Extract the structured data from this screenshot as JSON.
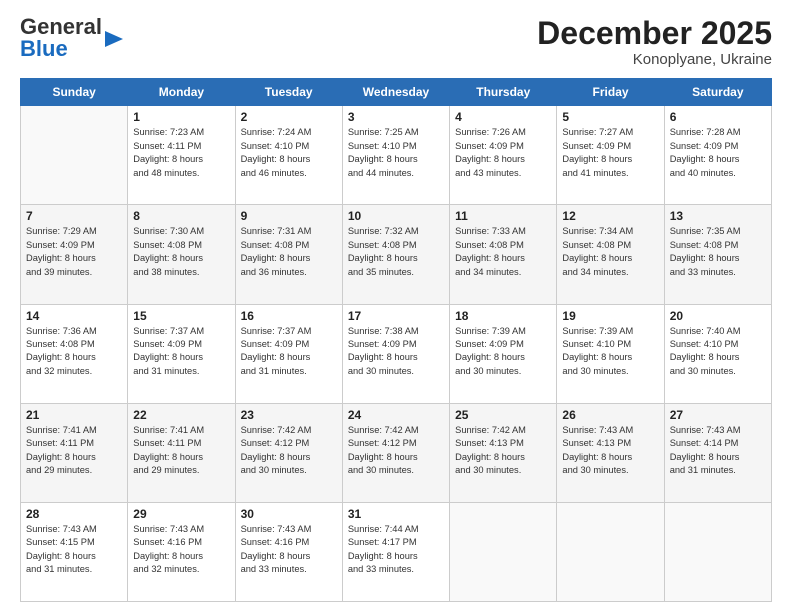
{
  "header": {
    "logo_general": "General",
    "logo_blue": "Blue",
    "month": "December 2025",
    "location": "Konoplyane, Ukraine"
  },
  "weekdays": [
    "Sunday",
    "Monday",
    "Tuesday",
    "Wednesday",
    "Thursday",
    "Friday",
    "Saturday"
  ],
  "weeks": [
    [
      {
        "day": "",
        "text": ""
      },
      {
        "day": "1",
        "text": "Sunrise: 7:23 AM\nSunset: 4:11 PM\nDaylight: 8 hours\nand 48 minutes."
      },
      {
        "day": "2",
        "text": "Sunrise: 7:24 AM\nSunset: 4:10 PM\nDaylight: 8 hours\nand 46 minutes."
      },
      {
        "day": "3",
        "text": "Sunrise: 7:25 AM\nSunset: 4:10 PM\nDaylight: 8 hours\nand 44 minutes."
      },
      {
        "day": "4",
        "text": "Sunrise: 7:26 AM\nSunset: 4:09 PM\nDaylight: 8 hours\nand 43 minutes."
      },
      {
        "day": "5",
        "text": "Sunrise: 7:27 AM\nSunset: 4:09 PM\nDaylight: 8 hours\nand 41 minutes."
      },
      {
        "day": "6",
        "text": "Sunrise: 7:28 AM\nSunset: 4:09 PM\nDaylight: 8 hours\nand 40 minutes."
      }
    ],
    [
      {
        "day": "7",
        "text": "Sunrise: 7:29 AM\nSunset: 4:09 PM\nDaylight: 8 hours\nand 39 minutes."
      },
      {
        "day": "8",
        "text": "Sunrise: 7:30 AM\nSunset: 4:08 PM\nDaylight: 8 hours\nand 38 minutes."
      },
      {
        "day": "9",
        "text": "Sunrise: 7:31 AM\nSunset: 4:08 PM\nDaylight: 8 hours\nand 36 minutes."
      },
      {
        "day": "10",
        "text": "Sunrise: 7:32 AM\nSunset: 4:08 PM\nDaylight: 8 hours\nand 35 minutes."
      },
      {
        "day": "11",
        "text": "Sunrise: 7:33 AM\nSunset: 4:08 PM\nDaylight: 8 hours\nand 34 minutes."
      },
      {
        "day": "12",
        "text": "Sunrise: 7:34 AM\nSunset: 4:08 PM\nDaylight: 8 hours\nand 34 minutes."
      },
      {
        "day": "13",
        "text": "Sunrise: 7:35 AM\nSunset: 4:08 PM\nDaylight: 8 hours\nand 33 minutes."
      }
    ],
    [
      {
        "day": "14",
        "text": "Sunrise: 7:36 AM\nSunset: 4:08 PM\nDaylight: 8 hours\nand 32 minutes."
      },
      {
        "day": "15",
        "text": "Sunrise: 7:37 AM\nSunset: 4:09 PM\nDaylight: 8 hours\nand 31 minutes."
      },
      {
        "day": "16",
        "text": "Sunrise: 7:37 AM\nSunset: 4:09 PM\nDaylight: 8 hours\nand 31 minutes."
      },
      {
        "day": "17",
        "text": "Sunrise: 7:38 AM\nSunset: 4:09 PM\nDaylight: 8 hours\nand 30 minutes."
      },
      {
        "day": "18",
        "text": "Sunrise: 7:39 AM\nSunset: 4:09 PM\nDaylight: 8 hours\nand 30 minutes."
      },
      {
        "day": "19",
        "text": "Sunrise: 7:39 AM\nSunset: 4:10 PM\nDaylight: 8 hours\nand 30 minutes."
      },
      {
        "day": "20",
        "text": "Sunrise: 7:40 AM\nSunset: 4:10 PM\nDaylight: 8 hours\nand 30 minutes."
      }
    ],
    [
      {
        "day": "21",
        "text": "Sunrise: 7:41 AM\nSunset: 4:11 PM\nDaylight: 8 hours\nand 29 minutes."
      },
      {
        "day": "22",
        "text": "Sunrise: 7:41 AM\nSunset: 4:11 PM\nDaylight: 8 hours\nand 29 minutes."
      },
      {
        "day": "23",
        "text": "Sunrise: 7:42 AM\nSunset: 4:12 PM\nDaylight: 8 hours\nand 30 minutes."
      },
      {
        "day": "24",
        "text": "Sunrise: 7:42 AM\nSunset: 4:12 PM\nDaylight: 8 hours\nand 30 minutes."
      },
      {
        "day": "25",
        "text": "Sunrise: 7:42 AM\nSunset: 4:13 PM\nDaylight: 8 hours\nand 30 minutes."
      },
      {
        "day": "26",
        "text": "Sunrise: 7:43 AM\nSunset: 4:13 PM\nDaylight: 8 hours\nand 30 minutes."
      },
      {
        "day": "27",
        "text": "Sunrise: 7:43 AM\nSunset: 4:14 PM\nDaylight: 8 hours\nand 31 minutes."
      }
    ],
    [
      {
        "day": "28",
        "text": "Sunrise: 7:43 AM\nSunset: 4:15 PM\nDaylight: 8 hours\nand 31 minutes."
      },
      {
        "day": "29",
        "text": "Sunrise: 7:43 AM\nSunset: 4:16 PM\nDaylight: 8 hours\nand 32 minutes."
      },
      {
        "day": "30",
        "text": "Sunrise: 7:43 AM\nSunset: 4:16 PM\nDaylight: 8 hours\nand 33 minutes."
      },
      {
        "day": "31",
        "text": "Sunrise: 7:44 AM\nSunset: 4:17 PM\nDaylight: 8 hours\nand 33 minutes."
      },
      {
        "day": "",
        "text": ""
      },
      {
        "day": "",
        "text": ""
      },
      {
        "day": "",
        "text": ""
      }
    ]
  ]
}
